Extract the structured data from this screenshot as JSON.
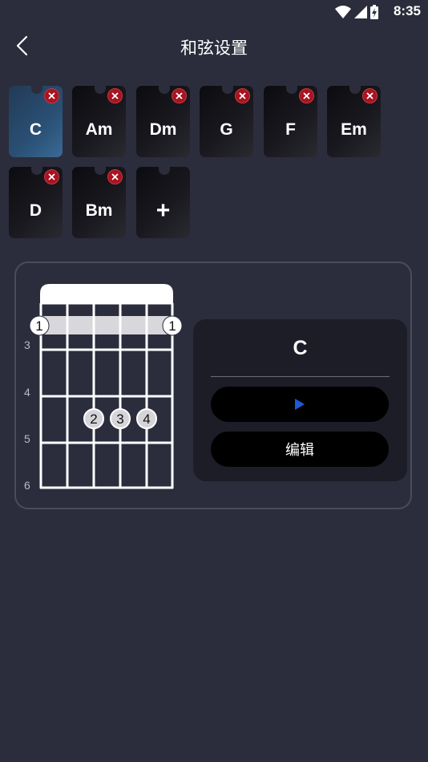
{
  "status_bar": {
    "time": "8:35",
    "battery_icon": "battery-charging-icon"
  },
  "header": {
    "title": "和弦设置",
    "back_icon": "back-chevron-icon"
  },
  "chord_tiles": [
    {
      "name": "C",
      "selected": true
    },
    {
      "name": "Am"
    },
    {
      "name": "Dm"
    },
    {
      "name": "G"
    },
    {
      "name": "F"
    },
    {
      "name": "Em"
    },
    {
      "name": "D"
    },
    {
      "name": "Bm"
    }
  ],
  "add_tile": {
    "label": "+"
  },
  "chord_diagram": {
    "fret_numbers": [
      "3",
      "4",
      "5",
      "6"
    ],
    "barre": {
      "left_finger": "1",
      "right_finger": "1"
    },
    "fingers": [
      "2",
      "3",
      "4"
    ]
  },
  "detail_card": {
    "chord_name": "C",
    "play_icon": "play-icon",
    "edit_label": "编辑"
  },
  "colors": {
    "background": "#2b2d3c",
    "selected_tile": "#2a5075",
    "delete_badge": "#a81420",
    "play_icon": "#1e5ad6"
  }
}
